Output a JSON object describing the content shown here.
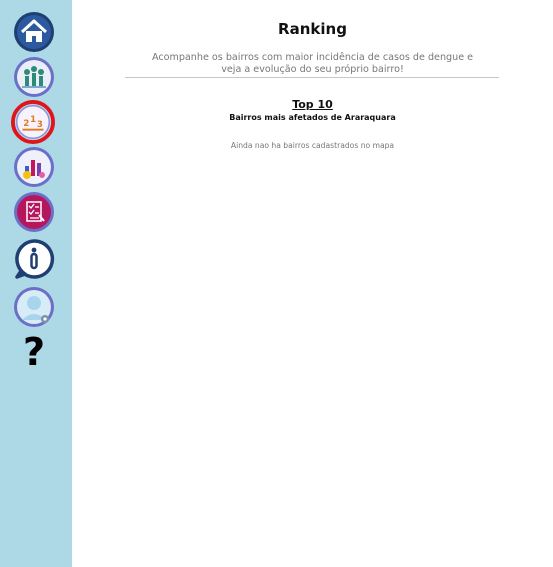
{
  "sidebar": {
    "items": [
      {
        "name": "home",
        "icon": "home-icon"
      },
      {
        "name": "community",
        "icon": "community-icon"
      },
      {
        "name": "ranking",
        "icon": "ranking-icon",
        "active": true,
        "active_ring_color": "#e2141b"
      },
      {
        "name": "stats",
        "icon": "bar-chart-icon"
      },
      {
        "name": "checklist",
        "icon": "checklist-icon"
      },
      {
        "name": "info",
        "icon": "info-icon"
      },
      {
        "name": "profile",
        "icon": "user-profile-icon"
      },
      {
        "name": "help",
        "icon": "question-mark-icon",
        "glyph": "?"
      }
    ]
  },
  "main": {
    "title": "Ranking",
    "subtitle": "Acompanhe os bairros com maior incidência de casos de dengue e veja a evolução do seu próprio bairro!",
    "top10_title": "Top 10",
    "top10_subtitle": "Bairros mais afetados de Araraquara",
    "empty_message": "Ainda nao ha bairros cadastrados no mapa"
  },
  "colors": {
    "sidebar_bg": "#add8e6",
    "icon_navy": "#1f3f72",
    "active_ring": "#e2141b",
    "muted_text": "#777777"
  }
}
